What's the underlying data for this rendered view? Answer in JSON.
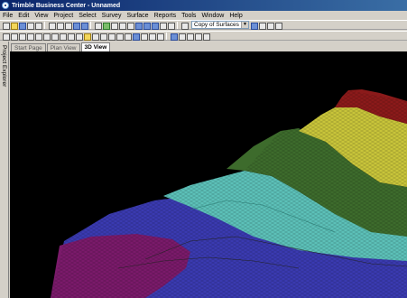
{
  "window": {
    "title": "Trimble Business Center - Unnamed"
  },
  "menu": [
    "File",
    "Edit",
    "View",
    "Project",
    "Select",
    "Survey",
    "Surface",
    "Reports",
    "Tools",
    "Window",
    "Help"
  ],
  "toolbar": {
    "surface_combo": "Copy of Surfaces"
  },
  "side_panel": {
    "label": "Project Explorer"
  },
  "tabs": [
    {
      "label": "Start Page",
      "active": false
    },
    {
      "label": "Plan View",
      "active": false
    },
    {
      "label": "3D View",
      "active": true
    }
  ],
  "surface_colors": [
    "#8b1a1a",
    "#c8c43a",
    "#3d6b2c",
    "#5cc0b8",
    "#3a3ab0",
    "#7a1a6a"
  ]
}
